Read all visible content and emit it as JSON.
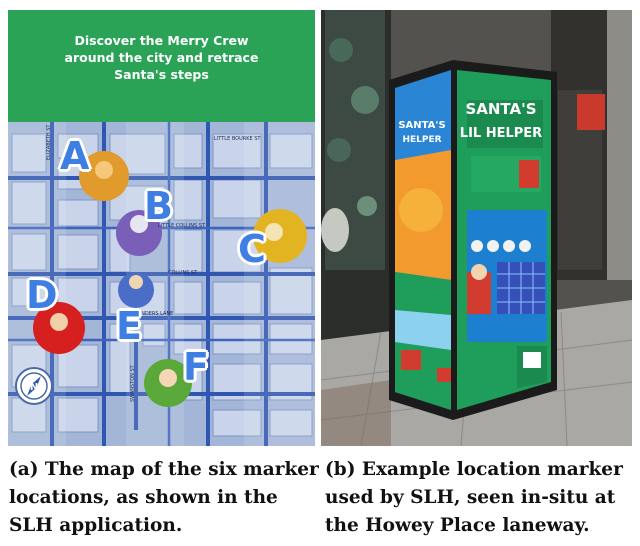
{
  "panel_a": {
    "header_text": [
      "Discover the Merry Crew",
      "around the city and retrace",
      "Santa's steps"
    ],
    "markers": [
      "A",
      "B",
      "C",
      "D",
      "E",
      "F"
    ],
    "street_labels": [
      "FLINDERS LANE",
      "COLLINS ST",
      "LITTLE COLLINS ST",
      "BOURKE ST",
      "LITTLE BOURKE ST",
      "ELIZABETH ST",
      "SWANSTON ST"
    ]
  },
  "panel_b": {
    "sign_title": "SANTA'S",
    "sign_subtitle": "LIL HELPER",
    "side_title": "SANTA'S",
    "side_subtitle": "HELPER"
  },
  "captions": {
    "a": "(a) The map of the six marker locations, as shown in the SLH application.",
    "b": "(b) Example location marker used by SLH, seen in-situ at the Howey Place laneway."
  }
}
